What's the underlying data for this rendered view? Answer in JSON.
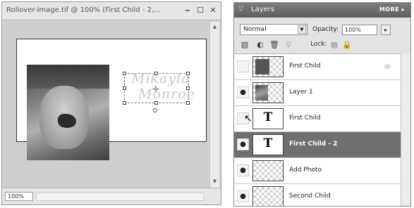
{
  "document": {
    "title": "Rollover-Image.tif @ 100% (First Child - 2,...",
    "zoom": "100%",
    "canvas_text_line1": "Mikayla",
    "canvas_text_line2": "Monroe",
    "minimize_glyph": "‒",
    "restore_glyph": "☐",
    "close_glyph": "✕"
  },
  "layers_panel": {
    "title": "Layers",
    "more_label": "MORE ▸",
    "blend_mode": "Normal",
    "opacity_label": "Opacity:",
    "opacity_value": "100%",
    "lock_label": "Lock:",
    "icons": [
      "new-layer-icon",
      "adjustment-layer-icon",
      "trash-icon",
      "link-icon",
      "lock-transparency-icon",
      "lock-all-icon"
    ],
    "layers": [
      {
        "name": "First Child",
        "visible": false,
        "thumb": "fill",
        "linked": true
      },
      {
        "name": "Layer 1",
        "visible": true,
        "thumb": "photo",
        "linked": false
      },
      {
        "name": "First Child",
        "visible": false,
        "thumb": "text",
        "linked": false
      },
      {
        "name": "First Child - 2",
        "visible": true,
        "thumb": "text",
        "linked": false,
        "selected": true
      },
      {
        "name": "Add Photo",
        "visible": true,
        "thumb": "empty",
        "linked": false
      },
      {
        "name": "Second Child",
        "visible": true,
        "thumb": "empty",
        "linked": false
      }
    ],
    "text_thumb_glyph": "T"
  },
  "colors": {
    "selected_row": "#6f6f6f",
    "panel_header": "#6b6b6b"
  }
}
